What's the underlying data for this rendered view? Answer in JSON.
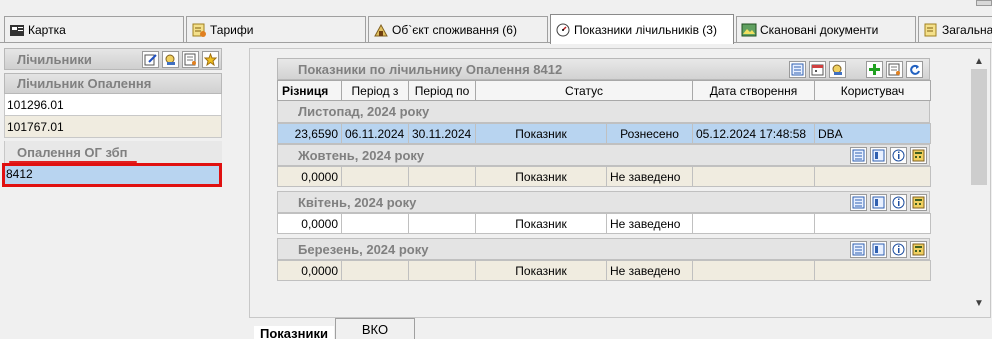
{
  "tabs": [
    {
      "label": "Картка",
      "icon": "card-icon"
    },
    {
      "label": "Тарифи",
      "icon": "tariff-icon"
    },
    {
      "label": "Об`єкт споживання (6)",
      "icon": "object-icon"
    },
    {
      "label": "Показники лічильників (3)",
      "icon": "meter-readings-icon",
      "active": true
    },
    {
      "label": "Скановані документи",
      "icon": "scan-icon"
    },
    {
      "label": "Загальна",
      "icon": "general-icon"
    }
  ],
  "left_panel": {
    "meters_title": "Лічильники",
    "meter_group_title": "Лічильник Опалення",
    "meters": [
      "101296.01",
      "101767.01"
    ],
    "heating_title": "Опалення ОГ збп",
    "heating_meter": "8412"
  },
  "readings": {
    "title": "Показники по лічильнику Опалення 8412",
    "columns": [
      "Різниця",
      "Період з",
      "Період по",
      "Статус",
      "Дата створення",
      "Користувач"
    ],
    "months": [
      {
        "label": "Листопад, 2024 року",
        "row": {
          "diff": "23,6590",
          "from": "06.11.2024",
          "to": "30.11.2024",
          "type": "Показник",
          "status": "Рознесено",
          "created": "05.12.2024 17:48:58",
          "user": "DBA"
        }
      },
      {
        "label": "Жовтень, 2024 року",
        "row": {
          "diff": "0,0000",
          "from": "",
          "to": "",
          "type": "Показник",
          "status": "Не заведено",
          "created": "",
          "user": ""
        }
      },
      {
        "label": "Квітень, 2024 року",
        "row": {
          "diff": "0,0000",
          "from": "",
          "to": "",
          "type": "Показник",
          "status": "Не заведено",
          "created": "",
          "user": ""
        }
      },
      {
        "label": "Березень, 2024 року",
        "row": {
          "diff": "0,0000",
          "from": "",
          "to": "",
          "type": "Показник",
          "status": "Не заведено",
          "created": "",
          "user": ""
        }
      }
    ]
  },
  "bottom_tabs": [
    {
      "label": "Показники",
      "active": true
    },
    {
      "label": "ВКО"
    }
  ],
  "colors": {
    "selected_row": "#b8d4f0",
    "highlight_red": "#e01010",
    "group_header_text": "#808080"
  }
}
